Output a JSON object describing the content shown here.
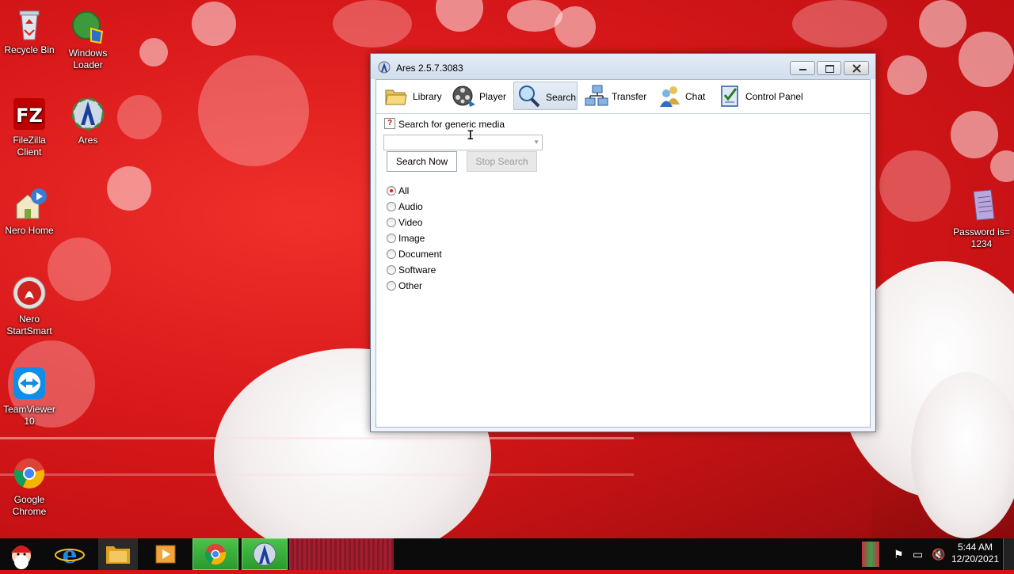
{
  "desktop": {
    "icons": [
      {
        "label": "Recycle Bin"
      },
      {
        "label": "Windows Loader"
      },
      {
        "label": "FileZilla Client"
      },
      {
        "label": "Ares"
      },
      {
        "label": "Nero Home"
      },
      {
        "label": "Nero StartSmart"
      },
      {
        "label": "TeamViewer 10"
      },
      {
        "label": "Google Chrome"
      },
      {
        "label": "Password is= 1234"
      }
    ]
  },
  "window": {
    "title": "Ares 2.5.7.3083",
    "toolbar": [
      {
        "label": "Library",
        "icon": "folder-icon"
      },
      {
        "label": "Player",
        "icon": "film-reel-icon"
      },
      {
        "label": "Search",
        "icon": "magnifier-icon",
        "active": true
      },
      {
        "label": "Transfer",
        "icon": "network-icon"
      },
      {
        "label": "Chat",
        "icon": "users-icon"
      },
      {
        "label": "Control Panel",
        "icon": "checklist-icon"
      }
    ],
    "search": {
      "heading": "Search for generic media",
      "query_value": "",
      "search_now_label": "Search Now",
      "stop_search_label": "Stop Search",
      "media_types": [
        "All",
        "Audio",
        "Video",
        "Image",
        "Document",
        "Software",
        "Other"
      ],
      "selected_type": "All"
    }
  },
  "taskbar": {
    "time": "5:44 AM",
    "date": "12/20/2021"
  },
  "colors": {
    "wallpaper": "#d41414",
    "taskbar": "#0b0b0b",
    "active_task": "#3aae3b"
  }
}
